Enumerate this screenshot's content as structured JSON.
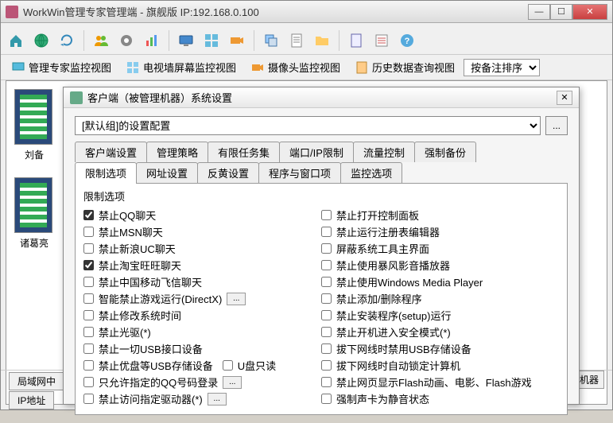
{
  "window": {
    "title": "WorkWin管理专家管理端 - 旗舰版 IP:192.168.0.100"
  },
  "viewbar": {
    "v1": "管理专家监控视图",
    "v2": "电视墙屏幕监控视图",
    "v3": "摄像头监控视图",
    "v4": "历史数据查询视图",
    "sort": "按备注排序"
  },
  "thumbs": {
    "name1": "刘备",
    "name2": "诸葛亮"
  },
  "bottom": {
    "tab1": "局域网中",
    "tab2": "IP地址"
  },
  "right_label": "监视机器",
  "dialog": {
    "title": "客户端（被管理机器）系统设置",
    "config": "[默认组]的设置配置",
    "browse": "...",
    "tabs_row1": [
      "客户端设置",
      "管理策略",
      "有限任务集",
      "端口/IP限制",
      "流量控制",
      "强制备份"
    ],
    "tabs_row2": [
      "限制选项",
      "网址设置",
      "反黄设置",
      "程序与窗口项",
      "监控选项"
    ],
    "group": "限制选项",
    "inline_readonly": "U盘只读",
    "left": [
      {
        "label": "禁止QQ聊天",
        "checked": true
      },
      {
        "label": "禁止MSN聊天",
        "checked": false
      },
      {
        "label": "禁止新浪UC聊天",
        "checked": false
      },
      {
        "label": "禁止淘宝旺旺聊天",
        "checked": true
      },
      {
        "label": "禁止中国移动飞信聊天",
        "checked": false
      },
      {
        "label": "智能禁止游戏运行(DirectX)",
        "checked": false,
        "extra": true
      },
      {
        "label": "禁止修改系统时间",
        "checked": false
      },
      {
        "label": "禁止光驱(*)",
        "checked": false
      },
      {
        "label": "禁止一切USB接口设备",
        "checked": false
      },
      {
        "label": "禁止优盘等USB存储设备",
        "checked": false,
        "inline": true
      },
      {
        "label": "只允许指定的QQ号码登录",
        "checked": false,
        "extra": true
      },
      {
        "label": "禁止访问指定驱动器(*)",
        "checked": false,
        "extra": true
      }
    ],
    "right": [
      {
        "label": "禁止打开控制面板",
        "checked": false
      },
      {
        "label": "禁止运行注册表编辑器",
        "checked": false
      },
      {
        "label": "屏蔽系统工具主界面",
        "checked": false
      },
      {
        "label": "禁止使用暴风影音播放器",
        "checked": false
      },
      {
        "label": "禁止使用Windows Media Player",
        "checked": false
      },
      {
        "label": "禁止添加/删除程序",
        "checked": false
      },
      {
        "label": "禁止安装程序(setup)运行",
        "checked": false
      },
      {
        "label": "禁止开机进入安全模式(*)",
        "checked": false
      },
      {
        "label": "拔下网线时禁用USB存储设备",
        "checked": false
      },
      {
        "label": "拔下网线时自动锁定计算机",
        "checked": false
      },
      {
        "label": "禁止网页显示Flash动画、电影、Flash游戏",
        "checked": false
      },
      {
        "label": "强制声卡为静音状态",
        "checked": false
      }
    ]
  }
}
